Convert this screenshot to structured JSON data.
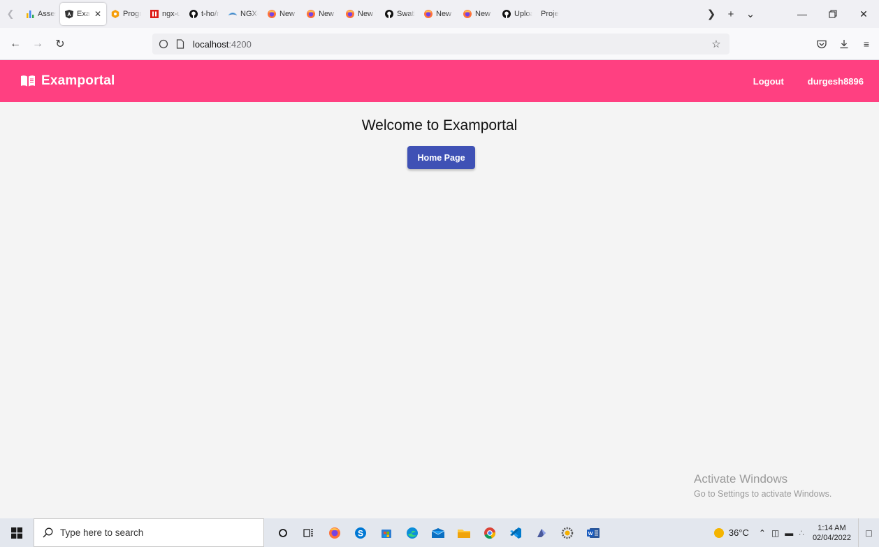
{
  "browser": {
    "tabs": [
      {
        "title": "Assess",
        "icon": "chart-icon"
      },
      {
        "title": "Exa",
        "icon": "angular-icon",
        "active": true
      },
      {
        "title": "Progre",
        "icon": "progress-icon"
      },
      {
        "title": "ngx-ui",
        "icon": "ngx-icon"
      },
      {
        "title": "t-ho/n",
        "icon": "github-icon"
      },
      {
        "title": "NGX-L",
        "icon": "ngx-loading-icon"
      },
      {
        "title": "New T",
        "icon": "firefox-icon"
      },
      {
        "title": "New T",
        "icon": "firefox-icon"
      },
      {
        "title": "New T",
        "icon": "firefox-icon"
      },
      {
        "title": "Swath",
        "icon": "github-icon"
      },
      {
        "title": "New T",
        "icon": "firefox-icon"
      },
      {
        "title": "New T",
        "icon": "firefox-icon"
      },
      {
        "title": "Uploa",
        "icon": "github-icon"
      },
      {
        "title": "Proje",
        "icon": "none"
      }
    ],
    "url_host": "localhost",
    "url_port": ":4200"
  },
  "app": {
    "title": "Examportal",
    "logout_label": "Logout",
    "username": "durgesh8896",
    "accent_color": "#ff4081",
    "primary_color": "#3f51b5"
  },
  "main": {
    "welcome": "Welcome to Examportal",
    "home_button": "Home Page"
  },
  "watermark": {
    "line1": "Activate Windows",
    "line2": "Go to Settings to activate Windows."
  },
  "taskbar": {
    "search_placeholder": "Type here to search",
    "temperature": "36°C",
    "time": "1:14 AM",
    "date": "02/04/2022"
  }
}
